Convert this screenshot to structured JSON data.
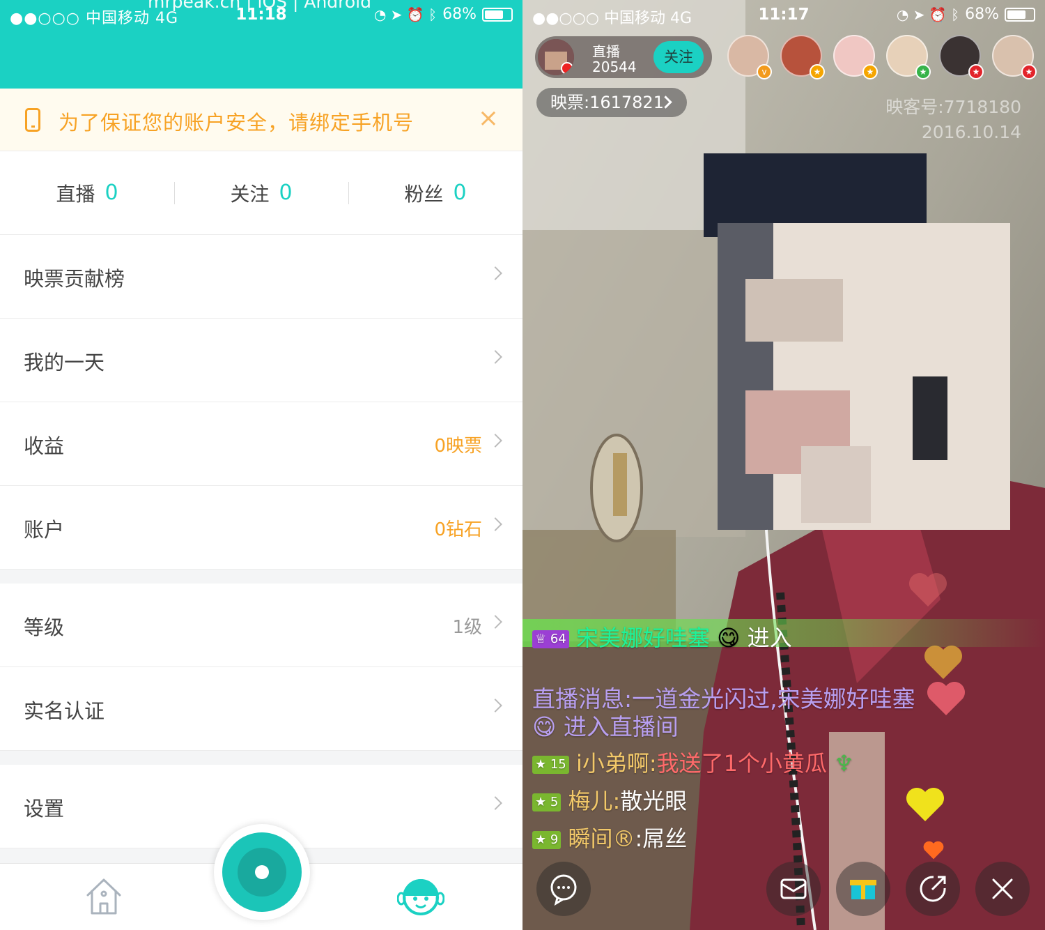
{
  "left_panel": {
    "status_bar": {
      "carrier": "●●○○○ 中国移动  4G",
      "time": "11:18",
      "battery": "68%"
    },
    "watermark": "mrpeak.cn | iOS | Android",
    "notice": {
      "text": "为了保证您的账户安全，请绑定手机号",
      "close": "×"
    },
    "stats": [
      {
        "label": "直播",
        "value": "0"
      },
      {
        "label": "关注",
        "value": "0"
      },
      {
        "label": "粉丝",
        "value": "0"
      }
    ],
    "menu": [
      {
        "label": "映票贡献榜",
        "value": ""
      },
      {
        "label": "我的一天",
        "value": ""
      },
      {
        "label": "收益",
        "value": "0映票"
      },
      {
        "label": "账户",
        "value": "0钻石"
      },
      {
        "label": "等级",
        "value": "1级"
      },
      {
        "label": "实名认证",
        "value": ""
      },
      {
        "label": "设置",
        "value": ""
      }
    ],
    "accent_color": "#1bd1c3",
    "highlight_color": "#f7a224"
  },
  "right_panel": {
    "status_bar": {
      "carrier": "●●○○○ 中国移动  4G",
      "time": "11:17",
      "battery": "68%"
    },
    "host": {
      "title": "直播",
      "count": "20544",
      "follow_label": "关注"
    },
    "ticket": "映票:1617821",
    "room_id": "映客号:7718180",
    "date": "2016.10.14",
    "enter_message": {
      "level": "64",
      "user": "宋美娜好哇塞",
      "action": "进入"
    },
    "system_message": {
      "line1": "直播消息:一道金光闪过,宋美娜好哇塞",
      "line2": "进入直播间"
    },
    "chats": [
      {
        "level": "15",
        "user": "i小弟啊:",
        "text": "我送了1个小黄瓜"
      },
      {
        "level": "5",
        "user": "梅儿:",
        "text": "散光眼"
      },
      {
        "level": "9",
        "user": "瞬间®",
        "text": ":屌丝"
      }
    ]
  }
}
